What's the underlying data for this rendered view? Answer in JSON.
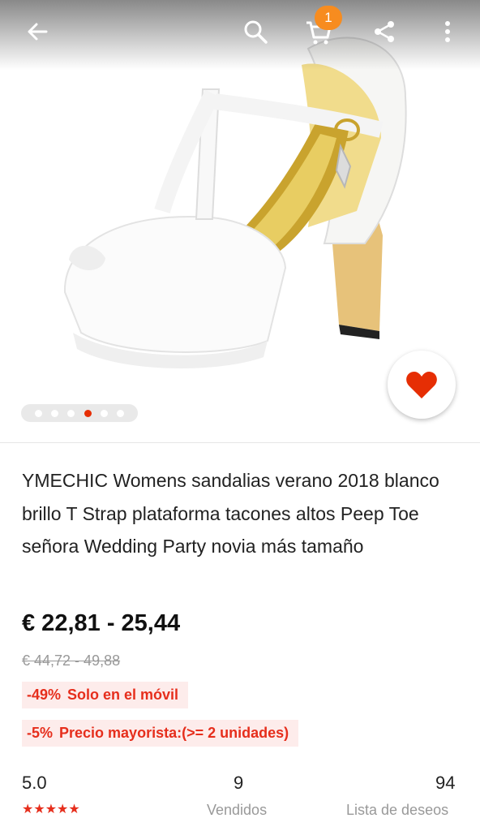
{
  "header": {
    "cart_count": "1"
  },
  "gallery": {
    "dot_count": 6,
    "active_index": 3
  },
  "product": {
    "title": "YMECHIC Womens sandalias verano 2018 blanco brillo T Strap plataforma tacones altos Peep Toe señora Wedding Party novia más tamaño",
    "price": "€ 22,81 - 25,44",
    "original_price": "€ 44,72 - 49,88",
    "tags": [
      {
        "percent": "-49%",
        "label": "Solo en el móvil"
      },
      {
        "percent": "-5%",
        "label": "Precio mayorista:(>= 2 unidades)"
      }
    ]
  },
  "stats": {
    "rating": "5.0",
    "stars": "★★★★★",
    "sold_count": "9",
    "sold_label": "Vendidos",
    "wishlist_count": "94",
    "wishlist_label": "Lista de deseos"
  },
  "colors": {
    "accent_red": "#e62e04",
    "badge_orange": "#f78c1f"
  },
  "icons": [
    "back-arrow-icon",
    "search-icon",
    "cart-icon",
    "share-icon",
    "more-vertical-icon",
    "heart-icon"
  ]
}
